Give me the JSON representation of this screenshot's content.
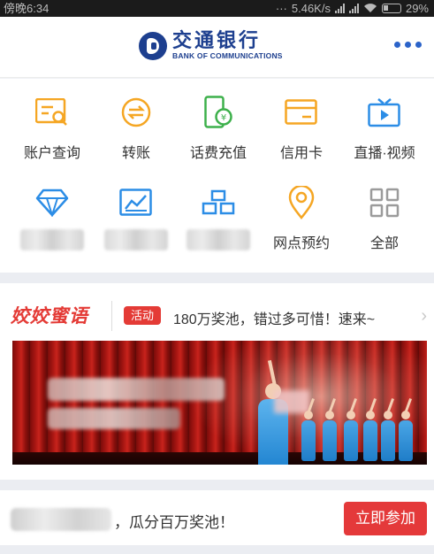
{
  "status_bar": {
    "time": "傍晚6:34",
    "network_speed": "5.46K/s",
    "battery_percent": "29%"
  },
  "header": {
    "logo_cn": "交通银行",
    "logo_en": "BANK OF COMMUNICATIONS",
    "more_icon": "more-dots-icon"
  },
  "grid": {
    "row1": [
      {
        "label": "账户查询",
        "icon": "account-query-icon",
        "color": "#f5a623"
      },
      {
        "label": "转账",
        "icon": "transfer-icon",
        "color": "#f5a623"
      },
      {
        "label": "话费充值",
        "icon": "phone-recharge-icon",
        "color": "#3db04b"
      },
      {
        "label": "信用卡",
        "icon": "credit-card-icon",
        "color": "#f5a623"
      },
      {
        "label": "直播·视频",
        "icon": "live-video-icon",
        "color": "#2c8de6"
      }
    ],
    "row2": [
      {
        "label": "",
        "icon": "diamond-icon",
        "color": "#2c8de6"
      },
      {
        "label": "",
        "icon": "chart-icon",
        "color": "#2c8de6"
      },
      {
        "label": "",
        "icon": "gold-bars-icon",
        "color": "#2c8de6"
      },
      {
        "label": "网点预约",
        "icon": "location-pin-icon",
        "color": "#f5a623"
      },
      {
        "label": "全部",
        "icon": "all-grid-icon",
        "color": "#9b9b9b"
      }
    ]
  },
  "activity": {
    "title": "姣姣蜜语",
    "badge": "活动",
    "text": "180万奖池，错过多可惜！速来~",
    "chevron": "›"
  },
  "promo": {
    "text": "，瓜分百万奖池！",
    "button_label": "立即参加"
  },
  "colors": {
    "accent_red": "#e43b36",
    "brand_blue": "#1d3f8f",
    "icon_orange": "#f5a623",
    "icon_blue": "#2c8de6",
    "icon_green": "#3db04b"
  }
}
